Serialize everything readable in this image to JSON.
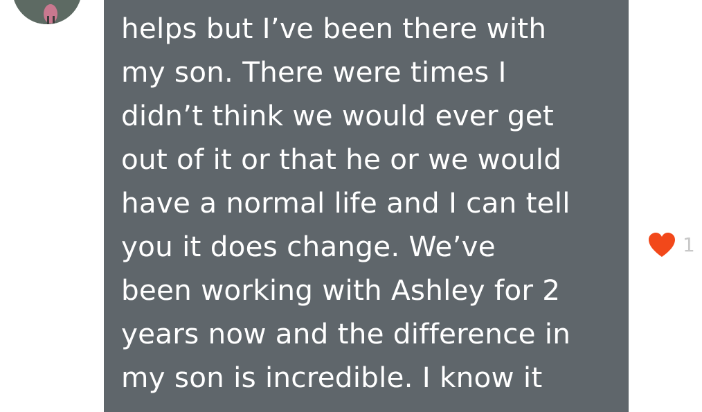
{
  "comment": {
    "lines": [
      "helps but I’ve been there with",
      "my son. There were times I",
      "didn’t think we would ever get",
      "out of it or that he or we would",
      "have a normal life and I can tell",
      "you it does change. We’ve",
      "been working with Ashley for 2",
      "years now and the difference in",
      "my son is incredible. I know it"
    ],
    "bubble_color": "#5f666b",
    "text_color": "#ffffff"
  },
  "likes": {
    "count": "1",
    "icon": "heart-icon",
    "color": "#f2481a"
  },
  "avatar": {
    "icon": "user-avatar"
  }
}
